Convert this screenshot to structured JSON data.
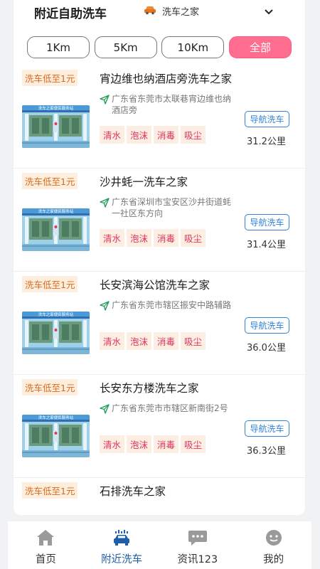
{
  "header": {
    "title": "附近自助洗车",
    "brand": "洗车之家"
  },
  "filters": [
    "1Km",
    "5Km",
    "10Km",
    "全部"
  ],
  "active_filter": "全部",
  "thumb_text": "洗车之家便民服务站",
  "colors": {
    "accent_pink": "#ff6e8f",
    "nav_blue": "#2f82d4",
    "tag_red": "#e0335a",
    "price_orange": "#d96a1c"
  },
  "stations": [
    {
      "price": "洗车低至1元",
      "name": "宵边维也纳酒店旁洗车之家",
      "address": "广东省东莞市太联巷宵边维也纳酒店旁",
      "tags": [
        "清水",
        "泡沫",
        "消毒",
        "吸尘"
      ],
      "nav": "导航洗车",
      "distance": "31.2公里"
    },
    {
      "price": "洗车低至1元",
      "name": "沙井蚝一洗车之家",
      "address": "广东省深圳市宝安区沙井街道蚝一社区东方向",
      "tags": [
        "清水",
        "泡沫",
        "消毒",
        "吸尘"
      ],
      "nav": "导航洗车",
      "distance": "31.4公里"
    },
    {
      "price": "洗车低至1元",
      "name": "长安滨海公馆洗车之家",
      "address": "广东省东莞市辖区振安中路辅路",
      "tags": [
        "清水",
        "泡沫",
        "消毒",
        "吸尘"
      ],
      "nav": "导航洗车",
      "distance": "36.0公里"
    },
    {
      "price": "洗车低至1元",
      "name": "长安东方楼洗车之家",
      "address": "广东省东莞市市辖区新南街2号",
      "tags": [
        "清水",
        "泡沫",
        "消毒",
        "吸尘"
      ],
      "nav": "导航洗车",
      "distance": "36.3公里"
    },
    {
      "price": "洗车低至1元",
      "name": "石排洗车之家"
    }
  ],
  "tabbar": [
    {
      "label": "首页",
      "icon": "home-icon"
    },
    {
      "label": "附近洗车",
      "icon": "car-wash-icon"
    },
    {
      "label": "资讯123",
      "icon": "chat-icon"
    },
    {
      "label": "我的",
      "icon": "profile-icon"
    }
  ],
  "active_tab": "附近洗车"
}
